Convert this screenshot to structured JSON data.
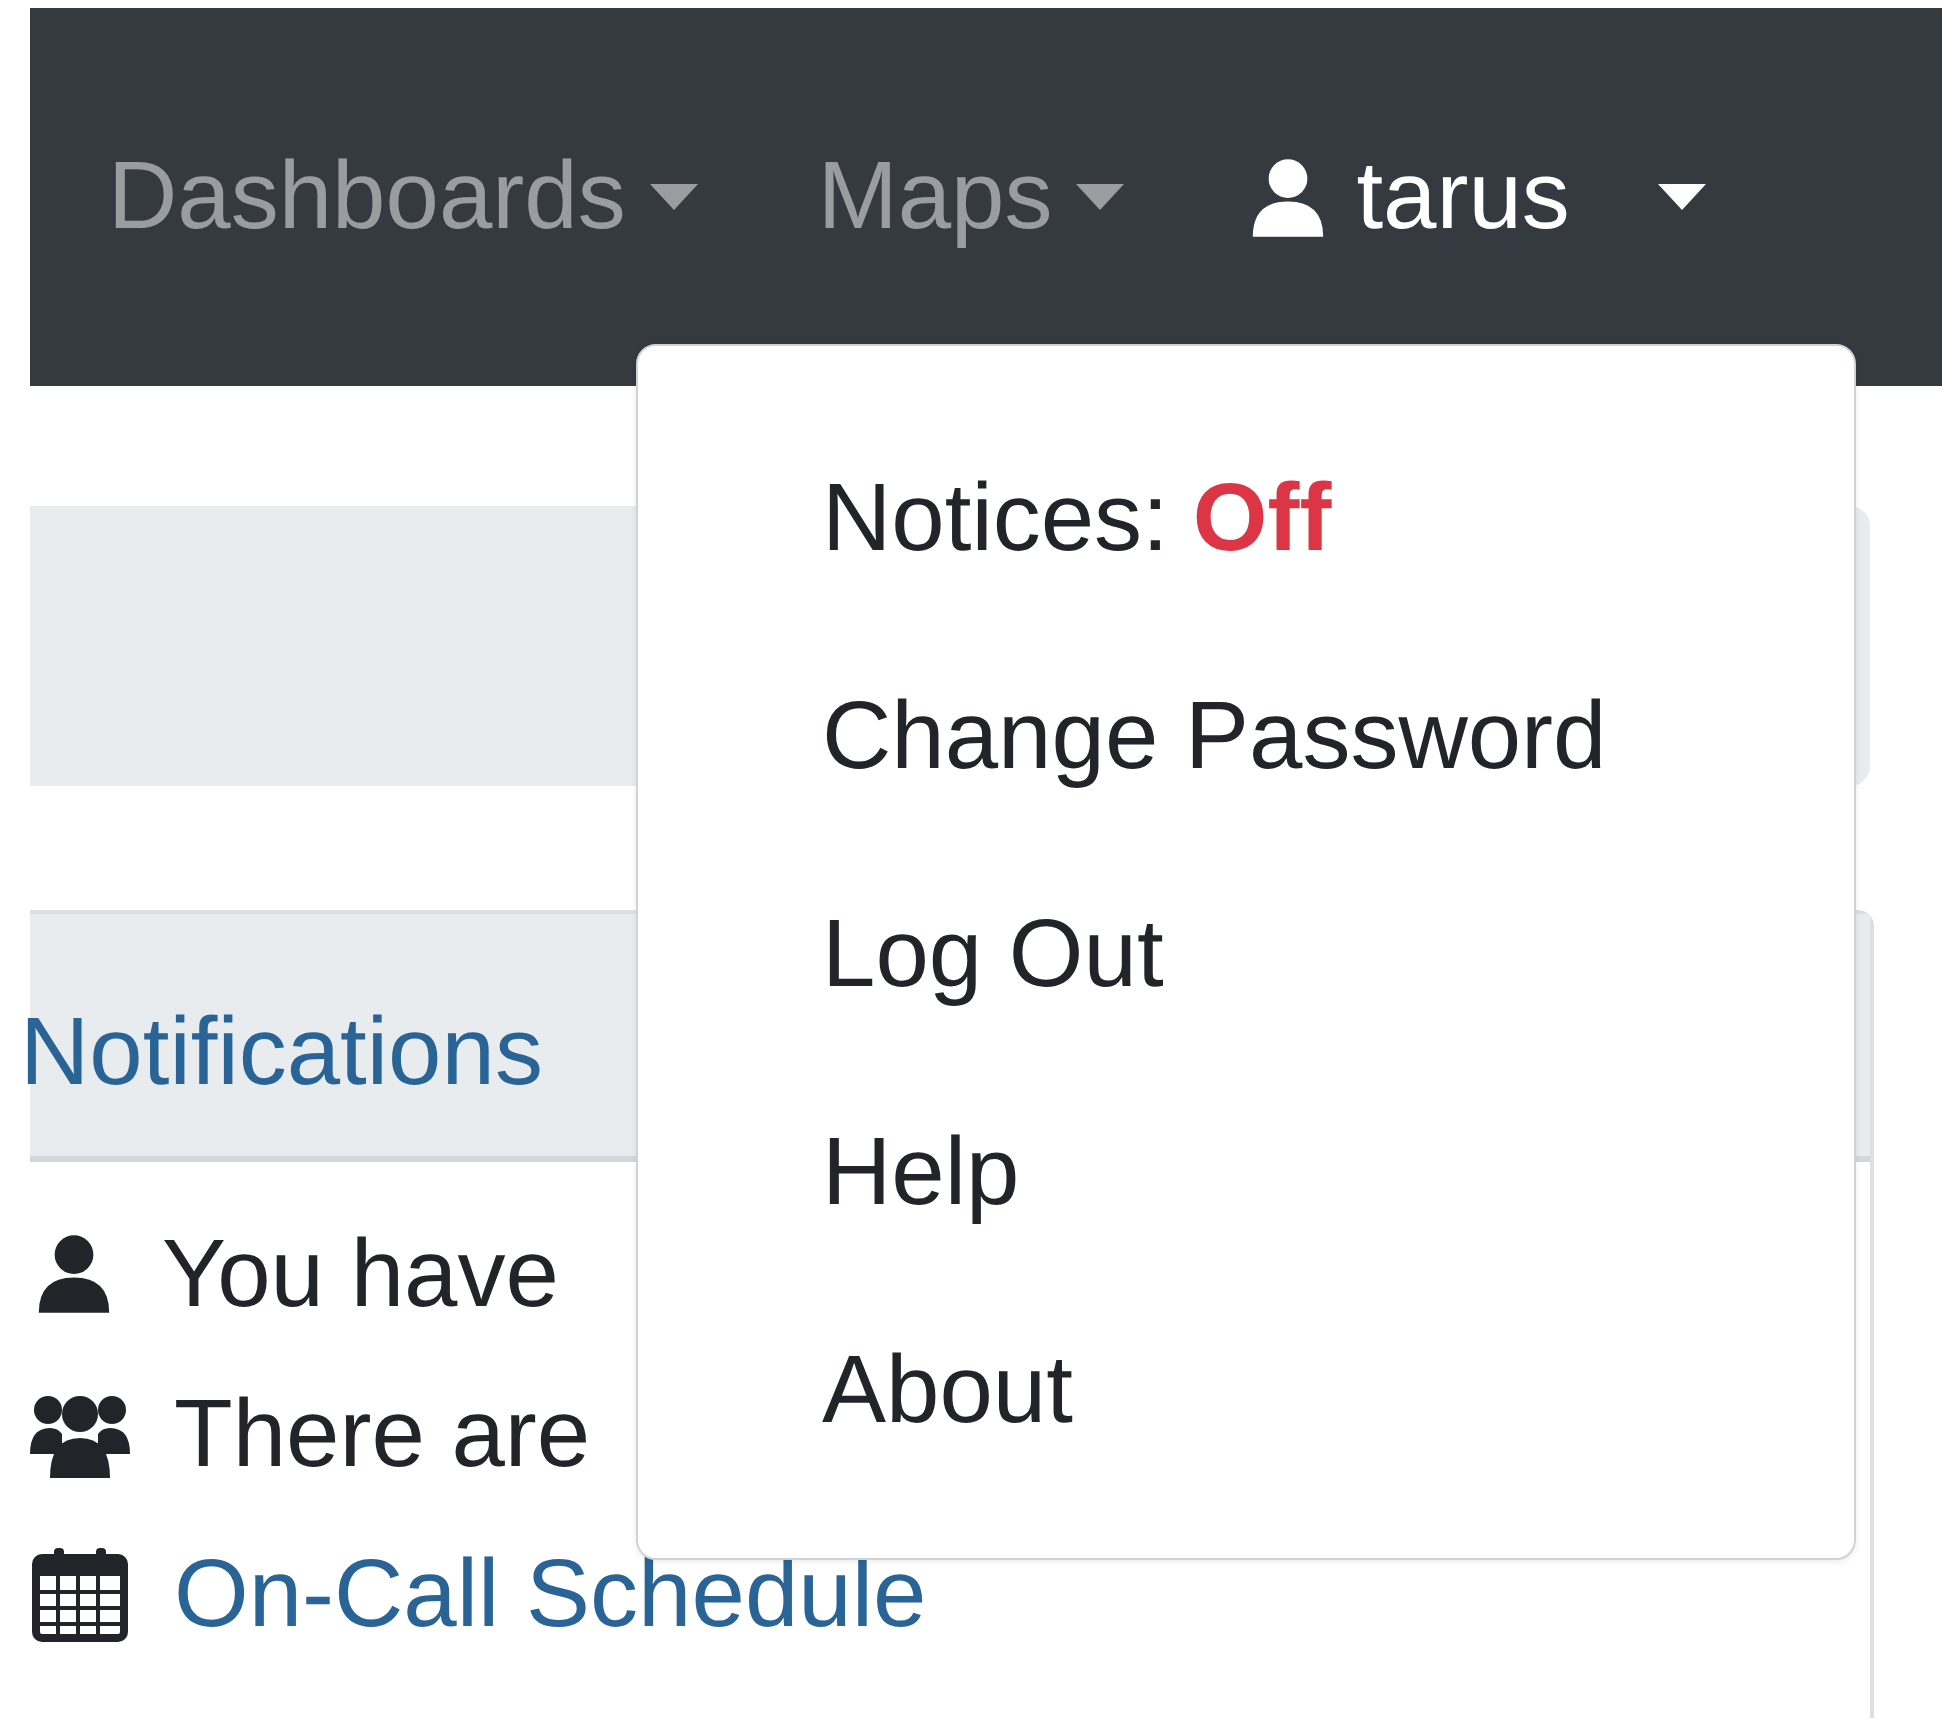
{
  "navbar": {
    "menus": [
      {
        "label": "Dashboards",
        "kind": "menu"
      },
      {
        "label": "Maps",
        "kind": "menu"
      },
      {
        "label": "tarus",
        "kind": "user",
        "expanded": true
      }
    ]
  },
  "user_menu": {
    "items": [
      {
        "kind": "notices",
        "label": "Notices:",
        "value": "Off",
        "on": false
      },
      {
        "kind": "link",
        "label": "Change Password"
      },
      {
        "kind": "link",
        "label": "Log Out"
      },
      {
        "kind": "link",
        "label": "Help"
      },
      {
        "kind": "link",
        "label": "About"
      }
    ]
  },
  "notifications": {
    "title": "Notifications",
    "items": [
      {
        "kind": "user",
        "text": "You have"
      },
      {
        "kind": "group",
        "text": "There are"
      },
      {
        "kind": "calendar",
        "text": "On-Call Schedule",
        "link": true
      }
    ]
  }
}
